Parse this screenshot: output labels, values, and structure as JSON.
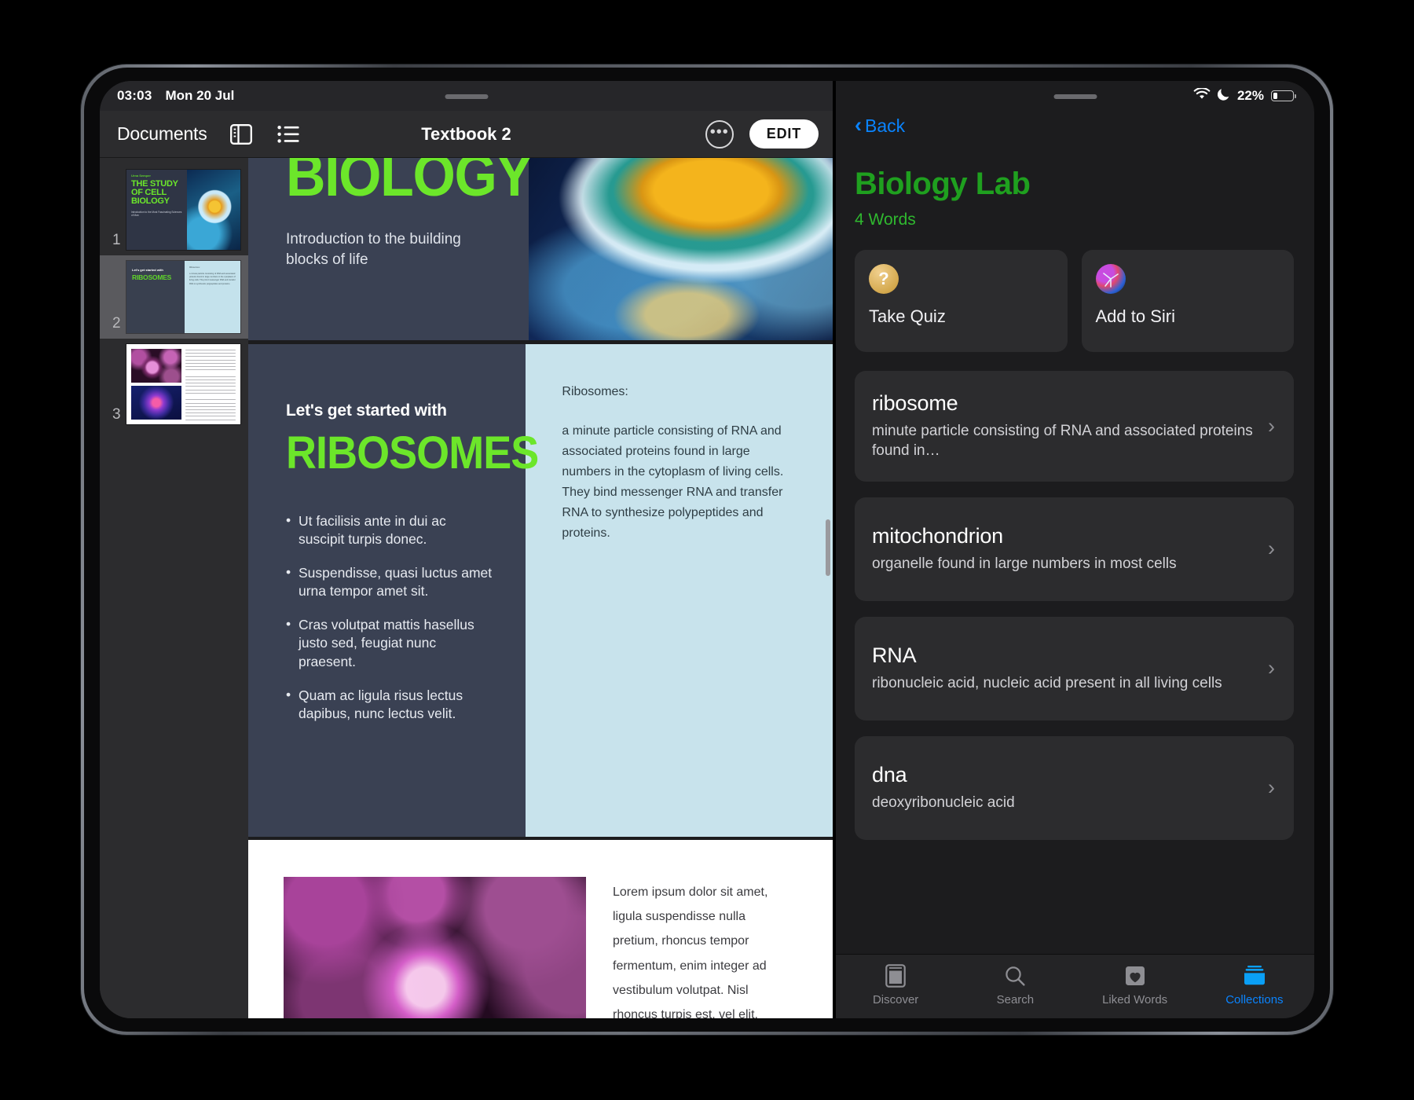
{
  "status_bar": {
    "time": "03:03",
    "date": "Mon 20 Jul",
    "wifi_icon": "wifi-icon",
    "moon_icon": "moon-icon",
    "battery_percent": "22%",
    "battery_level": 22
  },
  "documents_app": {
    "toolbar": {
      "back_label": "Documents",
      "sidebar_icon": "sidebar-toggle-icon",
      "list_icon": "list-view-icon",
      "title": "Textbook 2",
      "more_icon": "more-ellipsis-icon",
      "edit_label": "EDIT"
    },
    "thumbnails": [
      {
        "number": "1",
        "selected": false,
        "kind": "cover",
        "eyebrow": "Urna Semper",
        "title": "THE STUDY OF CELL BIOLOGY",
        "subtitle": "Introduction to the Most Fascinating Sciences of Man"
      },
      {
        "number": "2",
        "selected": true,
        "kind": "ribosomes",
        "kicker": "Let's get started with",
        "title": "RIBOSOMES"
      },
      {
        "number": "3",
        "selected": false,
        "kind": "photos"
      }
    ],
    "page_cover": {
      "title": "BIOLOGY",
      "subtitle": "Introduction to the building blocks of life",
      "hero_image": "cell-microscope-image"
    },
    "page_ribosomes": {
      "kicker": "Let's get started with",
      "title": "RIBOSOMES",
      "bullets": [
        "Ut facilisis ante in dui ac suscipit turpis donec.",
        "Suspendisse, quasi luctus amet urna tempor amet sit.",
        "Cras volutpat mattis hasellus justo sed, feugiat nunc praesent.",
        "Quam ac ligula risus lectus dapibus, nunc lectus velit."
      ],
      "note_heading": "Ribosomes:",
      "note_body": "a minute particle consisting of RNA and associated proteins found in large numbers in the cytoplasm of living cells. They bind messenger RNA and transfer RNA to synthesize polypeptides and proteins."
    },
    "page_photos": {
      "photo": "cells-magenta-image",
      "paragraph": "Lorem ipsum dolor sit amet, ligula suspendisse nulla pretium, rhoncus tempor fermentum, enim integer ad vestibulum volutpat. Nisl rhoncus turpis est, vel elit, congue wisi enim nunc ultricies sit, magna tincidunt."
    }
  },
  "dictionary_app": {
    "back_label": "Back",
    "back_icon": "chevron-left-icon",
    "collection_title": "Biology Lab",
    "collection_count": "4 Words",
    "accent_green": "#1fa01f",
    "accent_blue": "#0a84ff",
    "actions": [
      {
        "label": "Take Quiz",
        "icon": "question-mark-icon"
      },
      {
        "label": "Add to Siri",
        "icon": "siri-orb-icon"
      }
    ],
    "words": [
      {
        "term": "ribosome",
        "definition": "minute particle consisting of RNA and associated proteins found in…",
        "chevron": "chevron-right-icon"
      },
      {
        "term": "mitochondrion",
        "definition": "organelle found in large numbers in most cells",
        "chevron": "chevron-right-icon"
      },
      {
        "term": "RNA",
        "definition": "ribonucleic acid, nucleic acid present in all living cells",
        "chevron": "chevron-right-icon"
      },
      {
        "term": "dna",
        "definition": "deoxyribonucleic acid",
        "chevron": "chevron-right-icon"
      }
    ],
    "tabs": [
      {
        "label": "Discover",
        "icon": "book-icon",
        "active": false
      },
      {
        "label": "Search",
        "icon": "search-icon",
        "active": false
      },
      {
        "label": "Liked Words",
        "icon": "heart-icon",
        "active": false
      },
      {
        "label": "Collections",
        "icon": "collections-folder-icon",
        "active": true
      }
    ]
  }
}
